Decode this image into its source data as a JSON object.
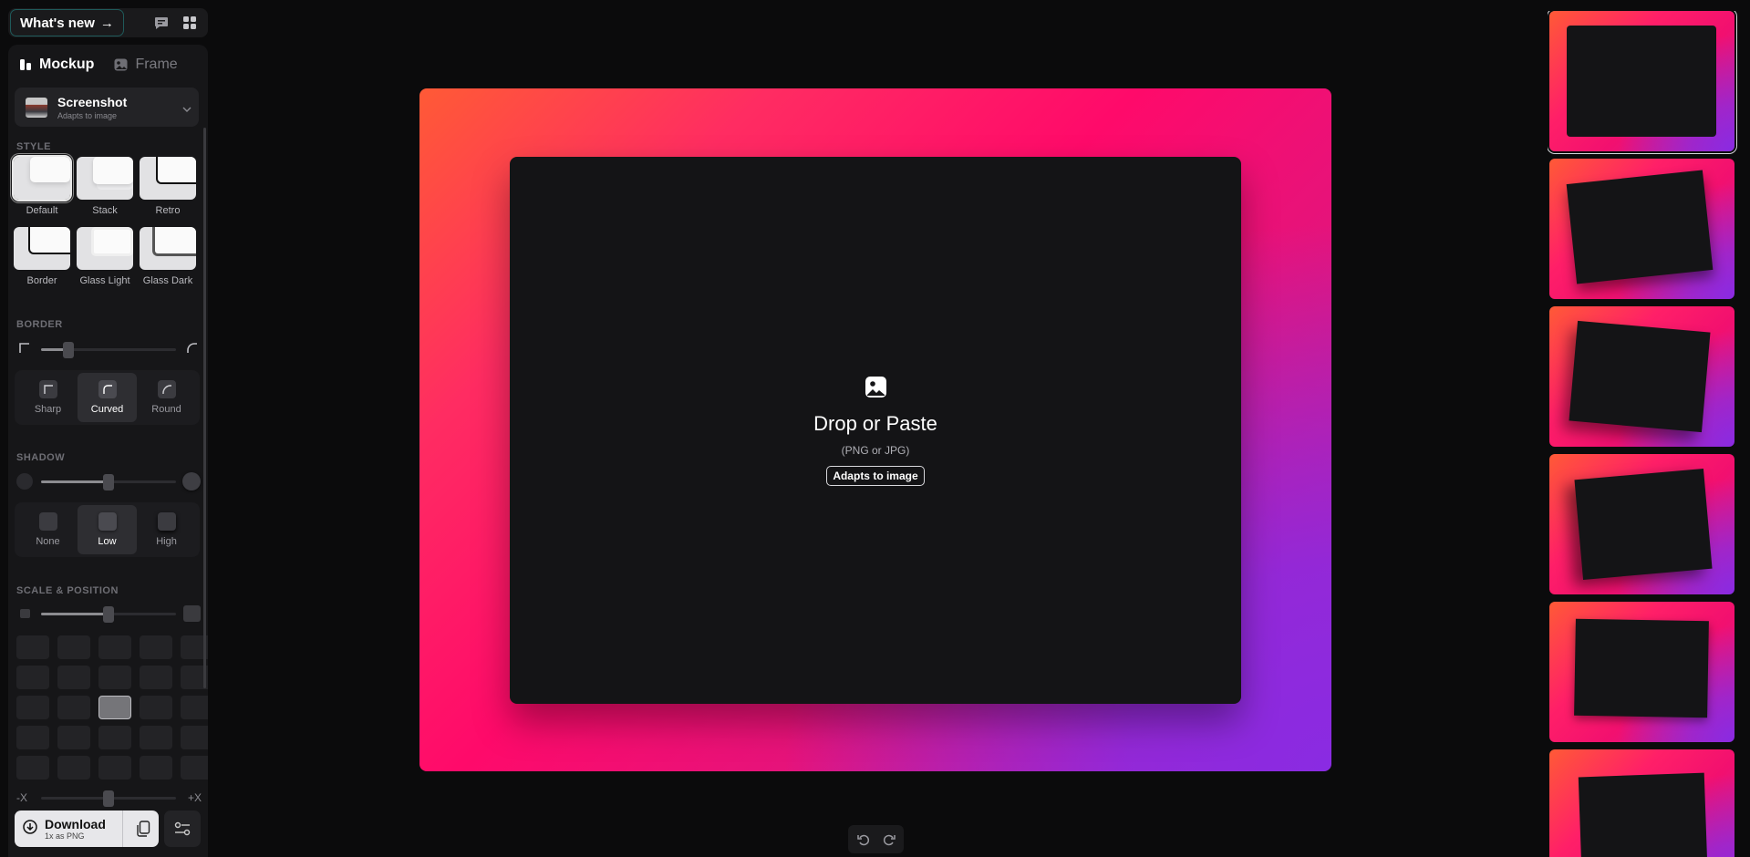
{
  "topbar": {
    "whats_new": "What's new",
    "arrow": "→",
    "icons": [
      "chat-icon",
      "apps-grid-icon"
    ]
  },
  "tabs": [
    {
      "label": "Mockup",
      "active": true
    },
    {
      "label": "Frame",
      "active": false
    }
  ],
  "mockup": {
    "title": "Screenshot",
    "subtitle": "Adapts to image"
  },
  "style": {
    "label": "STYLE",
    "options": [
      "Default",
      "Stack",
      "Retro",
      "Border",
      "Glass Light",
      "Glass Dark"
    ],
    "selected": "Default"
  },
  "border": {
    "label": "BORDER",
    "value": 0.2,
    "options": [
      "Sharp",
      "Curved",
      "Round"
    ],
    "selected": "Curved"
  },
  "shadow": {
    "label": "SHADOW",
    "value": 0.5,
    "options": [
      "None",
      "Low",
      "High"
    ],
    "selected": "Low"
  },
  "scale_position": {
    "label": "SCALE & POSITION",
    "scale": 0.5,
    "grid_rows": 5,
    "grid_cols": 5,
    "selected_cell": [
      2,
      2
    ],
    "x_min_label": "-X",
    "x_max_label": "+X",
    "x_offset": 0.5
  },
  "download": {
    "title": "Download",
    "subtitle": "1x as PNG"
  },
  "canvas": {
    "drop_title": "Drop or Paste",
    "drop_sub": "(PNG or JPG)",
    "badge": "Adapts to image"
  },
  "colors": {
    "background": "#0b0b0c",
    "panel": "#161618",
    "gradient_orange": "#ff5a36",
    "gradient_pink": "#ff0a6a",
    "gradient_purple": "#8a2be2"
  }
}
